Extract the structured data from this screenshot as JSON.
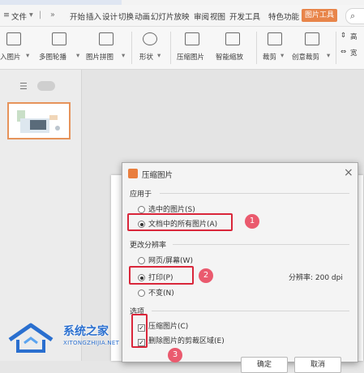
{
  "menu": {
    "file": "文件",
    "items": [
      "开始",
      "插入",
      "设计",
      "切换",
      "动画",
      "幻灯片放映",
      "审阅",
      "视图",
      "开发工具",
      "特色功能"
    ],
    "picture_tools": "图片工具"
  },
  "ribbon": {
    "buttons": [
      "入图片",
      "多图轮播",
      "图片拼图",
      "形状",
      "压缩图片",
      "智能缩放",
      "裁剪",
      "创意裁剪"
    ],
    "right_small_1": "高",
    "right_small_2": "宽"
  },
  "dialog": {
    "title": "压缩图片",
    "apply_to": {
      "label": "应用于",
      "options": [
        "选中的图片(S)",
        "文档中的所有图片(A)"
      ],
      "selected": 1
    },
    "resolution_group": {
      "label": "更改分辨率",
      "options": [
        "网页/屏幕(W)",
        "打印(P)",
        "不变(N)"
      ],
      "selected": 1,
      "resolution_text": "分辨率: 200 dpi"
    },
    "options_group": {
      "label": "选项",
      "checks": [
        "压缩图片(C)",
        "删除图片的剪裁区域(E)"
      ],
      "checked": [
        true,
        true
      ]
    },
    "buttons": [
      "确定",
      "取消"
    ]
  },
  "annotations": [
    "1",
    "2",
    "3"
  ],
  "watermark": {
    "title": "系统之家",
    "url": "XITONGZHIJIA.NET"
  },
  "colors": {
    "accent_orange": "#e8854a",
    "annotation_red": "#d9263a",
    "badge_pink": "#ea5a6e",
    "watermark_blue": "#2a6fcf"
  }
}
